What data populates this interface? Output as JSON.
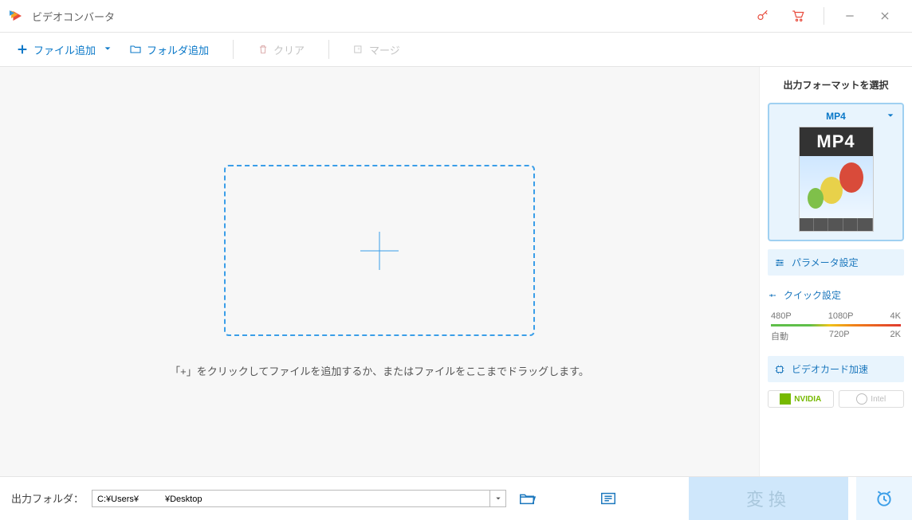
{
  "app": {
    "title": "ビデオコンバータ"
  },
  "toolbar": {
    "add_file": "ファイル追加",
    "add_folder": "フォルダ追加",
    "clear": "クリア",
    "merge": "マージ"
  },
  "workspace": {
    "hint": "「+」をクリックしてファイルを追加するか、またはファイルをここまでドラッグします。"
  },
  "sidebar": {
    "title": "出力フォーマットを選択",
    "selected_format": "MP4",
    "thumb_label": "MP4",
    "param_settings": "パラメータ設定",
    "quick_settings": "クイック設定",
    "res_top": {
      "a": "480P",
      "b": "1080P",
      "c": "4K"
    },
    "res_bot": {
      "a": "自動",
      "b": "720P",
      "c": "2K"
    },
    "gpu_accel": "ビデオカード加速",
    "nvidia": "NVIDIA",
    "intel": "Intel"
  },
  "footer": {
    "label": "出力フォルダ：",
    "path": "C:¥Users¥　　　¥Desktop",
    "convert": "変換"
  }
}
